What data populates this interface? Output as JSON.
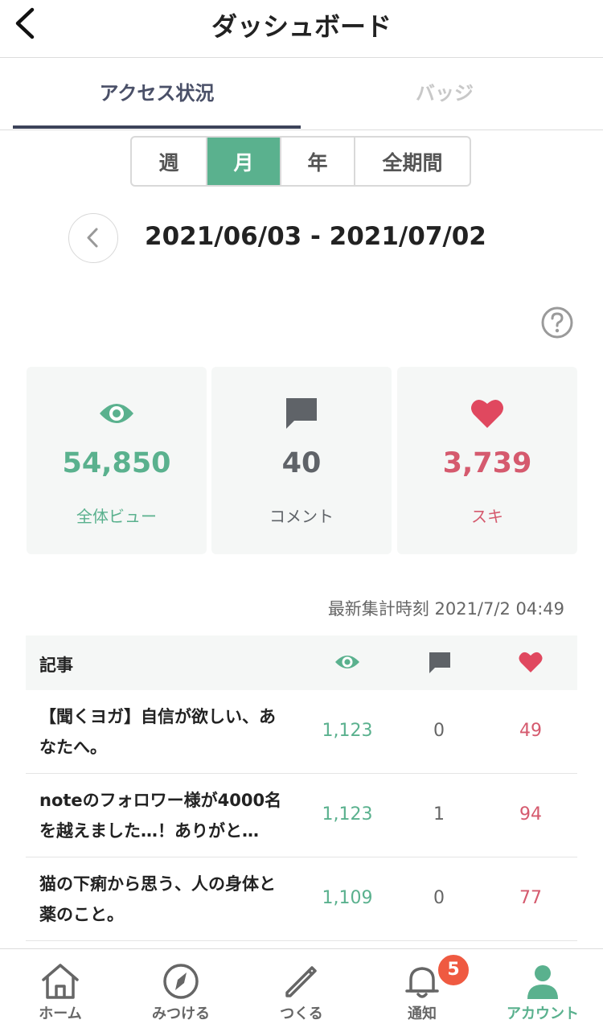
{
  "header": {
    "title": "ダッシュボード",
    "back_icon": "chevron-left-icon"
  },
  "tabs": [
    {
      "label": "アクセス状況",
      "active": true
    },
    {
      "label": "バッジ",
      "active": false
    }
  ],
  "period": {
    "options": [
      "週",
      "月",
      "年",
      "全期間"
    ],
    "selected": "月"
  },
  "date_range": "2021/06/03 - 2021/07/02",
  "help_icon": "question-circle-icon",
  "stats": {
    "views": {
      "value": "54,850",
      "label": "全体ビュー",
      "icon": "eye-icon",
      "color": "#5ab18e"
    },
    "comments": {
      "value": "40",
      "label": "コメント",
      "icon": "comment-icon",
      "color": "#5f6368"
    },
    "likes": {
      "value": "3,739",
      "label": "スキ",
      "icon": "heart-icon",
      "color": "#d55a6e"
    }
  },
  "updated": "最新集計時刻 2021/7/2 04:49",
  "table": {
    "header": {
      "label": "記事"
    },
    "rows": [
      {
        "title": "【聞くヨガ】自信が欲しい、あなたへ。",
        "views": "1,123",
        "comments": "0",
        "likes": "49"
      },
      {
        "title": "noteのフォロワー様が4000名を越えました…！ありがと…",
        "views": "1,123",
        "comments": "1",
        "likes": "94"
      },
      {
        "title": "猫の下痢から思う、人の身体と薬のこと。",
        "views": "1,109",
        "comments": "0",
        "likes": "77"
      }
    ]
  },
  "nav": {
    "items": [
      {
        "label": "ホーム",
        "icon": "home-icon"
      },
      {
        "label": "みつける",
        "icon": "compass-icon"
      },
      {
        "label": "つくる",
        "icon": "pencil-icon"
      },
      {
        "label": "通知",
        "icon": "bell-icon",
        "badge": "5"
      },
      {
        "label": "アカウント",
        "icon": "user-icon",
        "active": true
      }
    ]
  }
}
